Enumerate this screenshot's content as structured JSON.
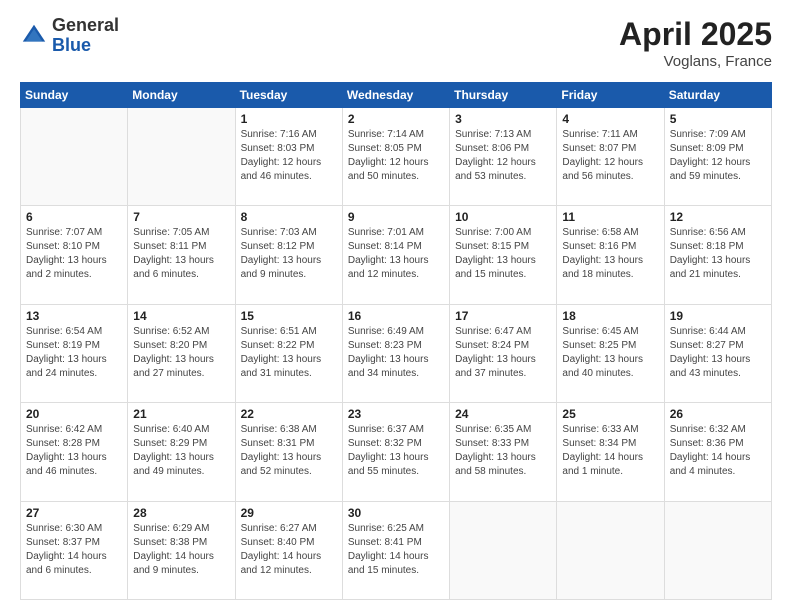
{
  "header": {
    "logo_general": "General",
    "logo_blue": "Blue",
    "title": "April 2025",
    "location": "Voglans, France"
  },
  "weekdays": [
    "Sunday",
    "Monday",
    "Tuesday",
    "Wednesday",
    "Thursday",
    "Friday",
    "Saturday"
  ],
  "weeks": [
    [
      {
        "day": "",
        "info": ""
      },
      {
        "day": "",
        "info": ""
      },
      {
        "day": "1",
        "info": "Sunrise: 7:16 AM\nSunset: 8:03 PM\nDaylight: 12 hours and 46 minutes."
      },
      {
        "day": "2",
        "info": "Sunrise: 7:14 AM\nSunset: 8:05 PM\nDaylight: 12 hours and 50 minutes."
      },
      {
        "day": "3",
        "info": "Sunrise: 7:13 AM\nSunset: 8:06 PM\nDaylight: 12 hours and 53 minutes."
      },
      {
        "day": "4",
        "info": "Sunrise: 7:11 AM\nSunset: 8:07 PM\nDaylight: 12 hours and 56 minutes."
      },
      {
        "day": "5",
        "info": "Sunrise: 7:09 AM\nSunset: 8:09 PM\nDaylight: 12 hours and 59 minutes."
      }
    ],
    [
      {
        "day": "6",
        "info": "Sunrise: 7:07 AM\nSunset: 8:10 PM\nDaylight: 13 hours and 2 minutes."
      },
      {
        "day": "7",
        "info": "Sunrise: 7:05 AM\nSunset: 8:11 PM\nDaylight: 13 hours and 6 minutes."
      },
      {
        "day": "8",
        "info": "Sunrise: 7:03 AM\nSunset: 8:12 PM\nDaylight: 13 hours and 9 minutes."
      },
      {
        "day": "9",
        "info": "Sunrise: 7:01 AM\nSunset: 8:14 PM\nDaylight: 13 hours and 12 minutes."
      },
      {
        "day": "10",
        "info": "Sunrise: 7:00 AM\nSunset: 8:15 PM\nDaylight: 13 hours and 15 minutes."
      },
      {
        "day": "11",
        "info": "Sunrise: 6:58 AM\nSunset: 8:16 PM\nDaylight: 13 hours and 18 minutes."
      },
      {
        "day": "12",
        "info": "Sunrise: 6:56 AM\nSunset: 8:18 PM\nDaylight: 13 hours and 21 minutes."
      }
    ],
    [
      {
        "day": "13",
        "info": "Sunrise: 6:54 AM\nSunset: 8:19 PM\nDaylight: 13 hours and 24 minutes."
      },
      {
        "day": "14",
        "info": "Sunrise: 6:52 AM\nSunset: 8:20 PM\nDaylight: 13 hours and 27 minutes."
      },
      {
        "day": "15",
        "info": "Sunrise: 6:51 AM\nSunset: 8:22 PM\nDaylight: 13 hours and 31 minutes."
      },
      {
        "day": "16",
        "info": "Sunrise: 6:49 AM\nSunset: 8:23 PM\nDaylight: 13 hours and 34 minutes."
      },
      {
        "day": "17",
        "info": "Sunrise: 6:47 AM\nSunset: 8:24 PM\nDaylight: 13 hours and 37 minutes."
      },
      {
        "day": "18",
        "info": "Sunrise: 6:45 AM\nSunset: 8:25 PM\nDaylight: 13 hours and 40 minutes."
      },
      {
        "day": "19",
        "info": "Sunrise: 6:44 AM\nSunset: 8:27 PM\nDaylight: 13 hours and 43 minutes."
      }
    ],
    [
      {
        "day": "20",
        "info": "Sunrise: 6:42 AM\nSunset: 8:28 PM\nDaylight: 13 hours and 46 minutes."
      },
      {
        "day": "21",
        "info": "Sunrise: 6:40 AM\nSunset: 8:29 PM\nDaylight: 13 hours and 49 minutes."
      },
      {
        "day": "22",
        "info": "Sunrise: 6:38 AM\nSunset: 8:31 PM\nDaylight: 13 hours and 52 minutes."
      },
      {
        "day": "23",
        "info": "Sunrise: 6:37 AM\nSunset: 8:32 PM\nDaylight: 13 hours and 55 minutes."
      },
      {
        "day": "24",
        "info": "Sunrise: 6:35 AM\nSunset: 8:33 PM\nDaylight: 13 hours and 58 minutes."
      },
      {
        "day": "25",
        "info": "Sunrise: 6:33 AM\nSunset: 8:34 PM\nDaylight: 14 hours and 1 minute."
      },
      {
        "day": "26",
        "info": "Sunrise: 6:32 AM\nSunset: 8:36 PM\nDaylight: 14 hours and 4 minutes."
      }
    ],
    [
      {
        "day": "27",
        "info": "Sunrise: 6:30 AM\nSunset: 8:37 PM\nDaylight: 14 hours and 6 minutes."
      },
      {
        "day": "28",
        "info": "Sunrise: 6:29 AM\nSunset: 8:38 PM\nDaylight: 14 hours and 9 minutes."
      },
      {
        "day": "29",
        "info": "Sunrise: 6:27 AM\nSunset: 8:40 PM\nDaylight: 14 hours and 12 minutes."
      },
      {
        "day": "30",
        "info": "Sunrise: 6:25 AM\nSunset: 8:41 PM\nDaylight: 14 hours and 15 minutes."
      },
      {
        "day": "",
        "info": ""
      },
      {
        "day": "",
        "info": ""
      },
      {
        "day": "",
        "info": ""
      }
    ]
  ]
}
